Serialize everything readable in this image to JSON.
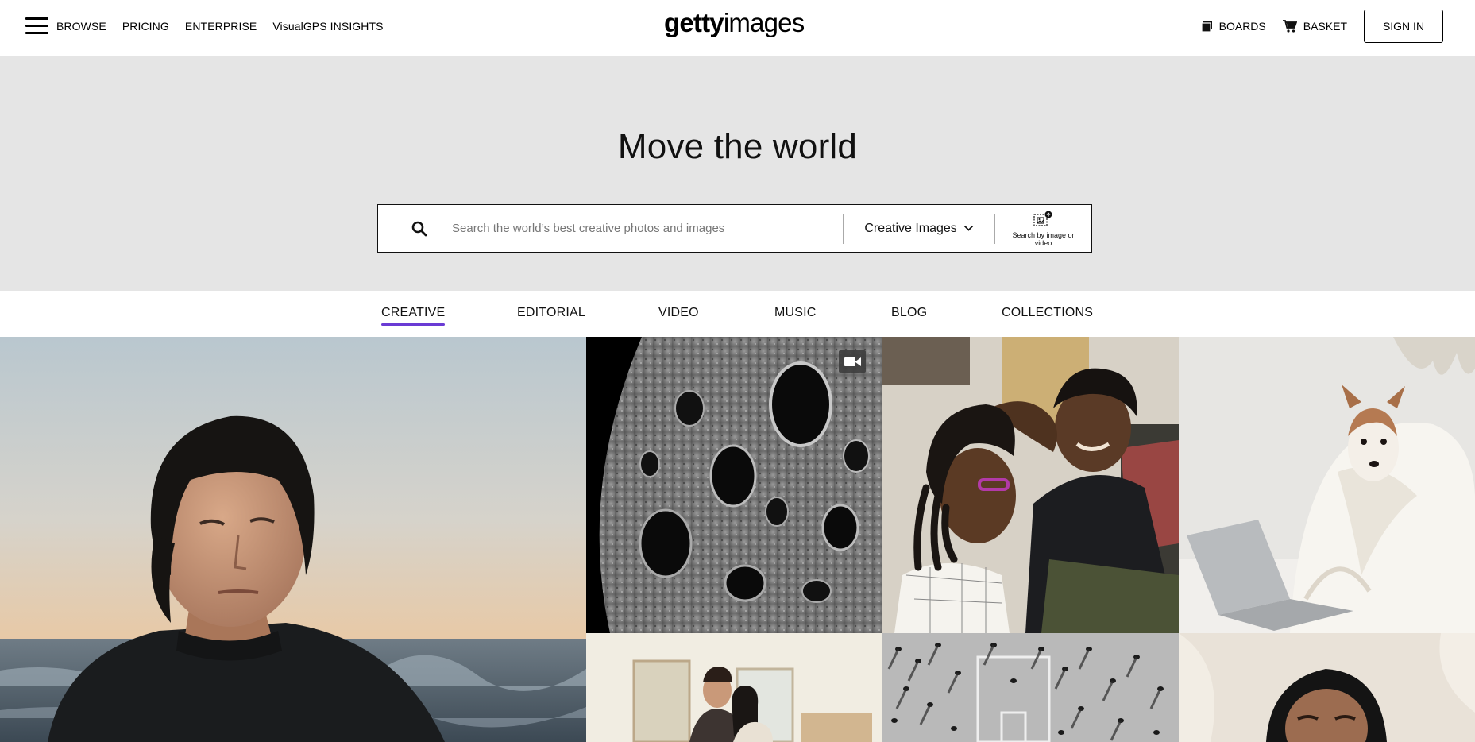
{
  "header": {
    "nav_left": [
      "BROWSE",
      "PRICING",
      "ENTERPRISE",
      "VisualGPS INSIGHTS"
    ],
    "logo_bold": "getty",
    "logo_light": "images",
    "boards_label": "BOARDS",
    "basket_label": "BASKET",
    "signin_label": "SIGN IN",
    "icons": [
      "menu-icon",
      "boards-icon",
      "basket-icon"
    ]
  },
  "hero": {
    "title": "Move the world",
    "search": {
      "placeholder": "Search the world’s best creative photos and images",
      "value": "",
      "scope_label": "Creative Images",
      "visual_search_label": "Search by image or video",
      "icons": [
        "search-icon",
        "chevron-down-icon",
        "image-search-icon"
      ]
    },
    "background_color": "#e5e5e5"
  },
  "tabs": {
    "items": [
      "CREATIVE",
      "EDITORIAL",
      "VIDEO",
      "MUSIC",
      "BLOG",
      "COLLECTIONS"
    ],
    "active": "CREATIVE",
    "accent_color": "#6a3bd4"
  },
  "gallery": {
    "tiles": [
      {
        "subject": "man in wetsuit at beach sunset"
      },
      {
        "subject": "moon surface craters",
        "badge": "video-camera-icon"
      },
      {
        "subject": "father braiding daughter's hair"
      },
      {
        "subject": "dog under blanket with laptop"
      },
      {
        "subject": "couple in bright room"
      },
      {
        "subject": "aerial crowd shadows black and white"
      },
      {
        "subject": "woman in headscarf smiling"
      }
    ]
  }
}
